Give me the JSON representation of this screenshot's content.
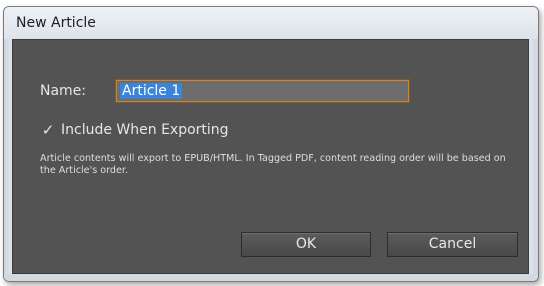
{
  "dialog": {
    "title": "New Article",
    "name_label": "Name:",
    "name_value": "Article 1",
    "include_checked": true,
    "check_glyph": "✓",
    "include_label": "Include When Exporting",
    "description": "Article contents will export to EPUB/HTML. In Tagged PDF, content reading order will be based on the Article's order.",
    "ok_label": "OK",
    "cancel_label": "Cancel"
  },
  "colors": {
    "panel_bg": "#535353",
    "input_focus_border": "#d1842a",
    "selection_bg": "#3a85d8"
  },
  "icons": {
    "checkbox": "checkmark-icon"
  }
}
